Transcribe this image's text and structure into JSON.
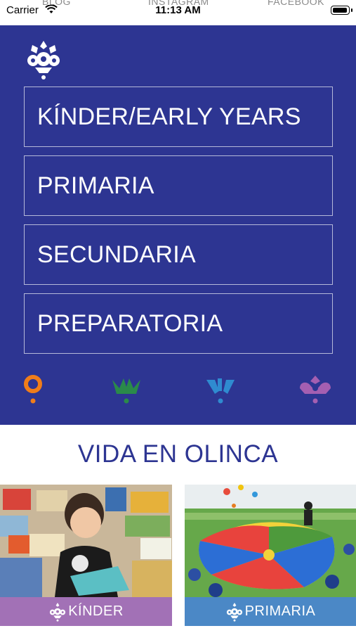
{
  "status_bar": {
    "carrier": "Carrier",
    "time": "11:13 AM",
    "behind_links": [
      "BLOG",
      "INSTAGRAM",
      "FACEBOOK"
    ]
  },
  "colors": {
    "hero_bg": "#2d3592",
    "orange": "#f07d1a",
    "green": "#2a8a4a",
    "blue": "#2f8bd0",
    "purple": "#a45fb1",
    "kinder_bar": "#a271b6",
    "primaria_bar": "#4b88c6"
  },
  "logo_icon": "olinca-logo-icon",
  "menu": {
    "items": [
      {
        "label": "KÍNDER/EARLY YEARS"
      },
      {
        "label": "PRIMARIA"
      },
      {
        "label": "SECUNDARIA"
      },
      {
        "label": "PREPARATORIA"
      }
    ]
  },
  "glyph_icons": [
    "orange-glyph-icon",
    "green-glyph-icon",
    "blue-glyph-icon",
    "purple-glyph-icon"
  ],
  "vida": {
    "title": "VIDA EN OLINCA",
    "cards": [
      {
        "label": "KÍNDER",
        "photo": "child-with-books-photo"
      },
      {
        "label": "PRIMARIA",
        "photo": "parachute-game-photo"
      }
    ]
  }
}
